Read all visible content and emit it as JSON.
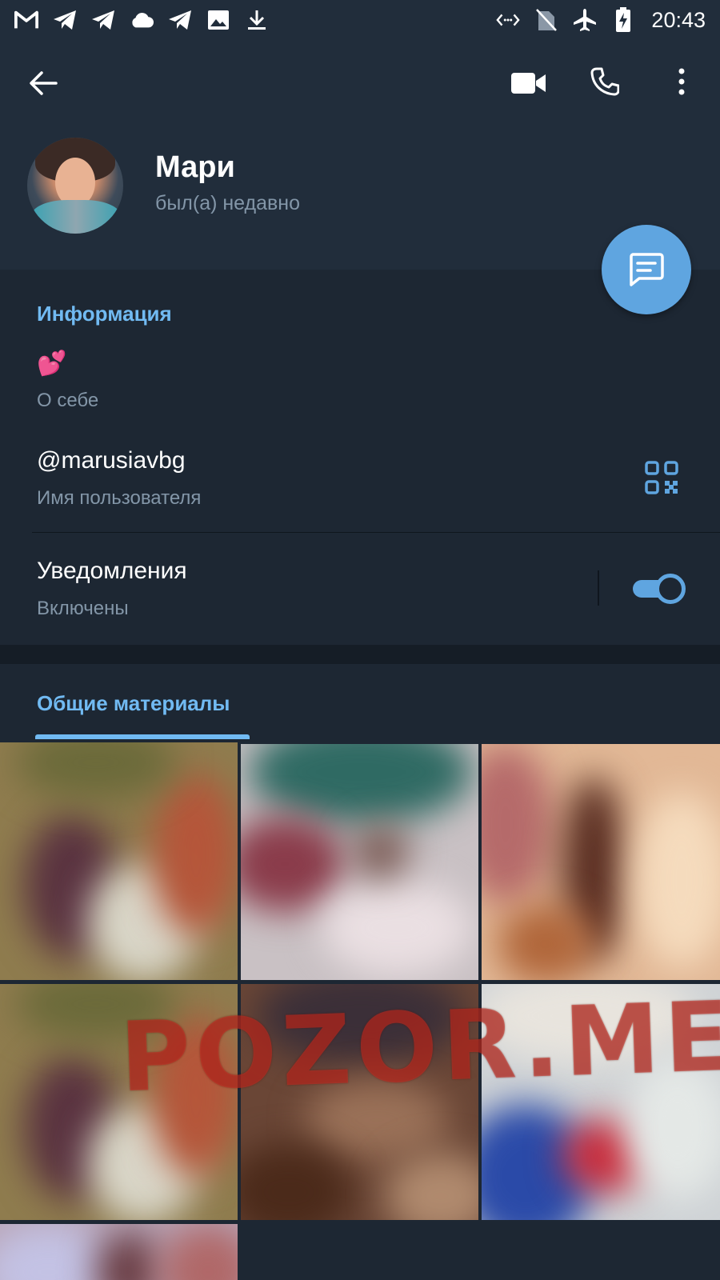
{
  "status_bar": {
    "time": "20:43",
    "left_icons": [
      "gmail-icon",
      "telegram-icon",
      "telegram-icon",
      "cloud-icon",
      "telegram-icon",
      "image-icon",
      "download-icon"
    ],
    "right_icons": [
      "data-transfer-icon",
      "no-sim-icon",
      "airplane-mode-icon",
      "battery-charging-icon"
    ]
  },
  "header": {
    "back_icon": "back-arrow-icon",
    "video_icon": "video-call-icon",
    "call_icon": "phone-icon",
    "more_icon": "more-vertical-icon"
  },
  "profile": {
    "name": "Мари",
    "status": "был(а) недавно"
  },
  "fab": {
    "icon": "message-icon"
  },
  "info": {
    "section_title": "Информация",
    "bio": "💕",
    "bio_label": "О себе",
    "username": "@marusiavbg",
    "username_label": "Имя пользователя",
    "qr_icon": "qr-code-icon",
    "notifications_title": "Уведомления",
    "notifications_value": "Включены",
    "notifications_enabled": true
  },
  "media": {
    "tab_title": "Общие материалы"
  },
  "watermark": "POZOR.ME",
  "colors": {
    "background": "#1d2733",
    "header": "#212d3b",
    "accent": "#5fa5e0",
    "accent_text": "#71baf2",
    "secondary_text": "#8396a8"
  }
}
